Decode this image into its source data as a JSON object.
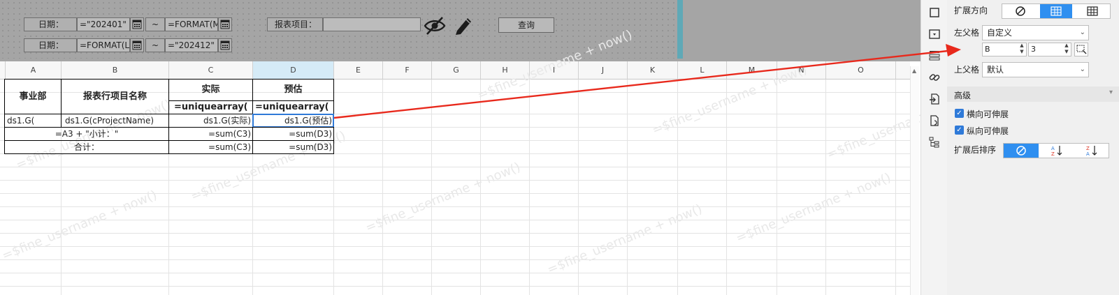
{
  "params": {
    "row1": {
      "label": "日期：",
      "start": "=\"202401\"",
      "tilde": "~",
      "end": "=FORMAT(M"
    },
    "row2": {
      "label": "日期：",
      "start": "=FORMAT(LE",
      "tilde": "~",
      "end": "=\"202412\""
    },
    "project_label": "报表项目：",
    "query_button": "查询"
  },
  "columns": [
    "A",
    "B",
    "C",
    "D",
    "E",
    "F",
    "G",
    "H",
    "I",
    "J",
    "K",
    "L",
    "M",
    "N",
    "O"
  ],
  "table": {
    "h_dept": "事业部",
    "h_project": "报表行项目名称",
    "h_actual": "实际",
    "h_estimate": "预估",
    "f_actual": "=uniquearray(",
    "f_estimate": "=uniquearray(",
    "r3_a": "ds1.G(",
    "r3_b": "ds1.G(cProjectName)",
    "r3_c": "ds1.G(实际)",
    "r3_d": "ds1.G(预估)",
    "r4_ab": "=A3 + \"小计：\"",
    "r4_c": "=sum(C3)",
    "r4_d": "=sum(D3)",
    "r5_ab": "合计：",
    "r5_c": "=sum(C3)",
    "r5_d": "=sum(D3)"
  },
  "watermark": "=$fine_username + now()",
  "panel": {
    "expand_dir_label": "扩展方向",
    "left_parent_label": "左父格",
    "left_parent_value": "自定义",
    "left_parent_col": "B",
    "left_parent_row": "3",
    "up_parent_label": "上父格",
    "up_parent_value": "默认",
    "advanced_label": "高级",
    "h_stretch": "横向可伸展",
    "v_stretch": "纵向可伸展",
    "sort_label": "扩展后排序"
  },
  "colors": {
    "accent": "#2f8ff0",
    "selection": "#2f7ad8",
    "arrow": "#e8291c",
    "param_bg": "#a5a5a5"
  }
}
